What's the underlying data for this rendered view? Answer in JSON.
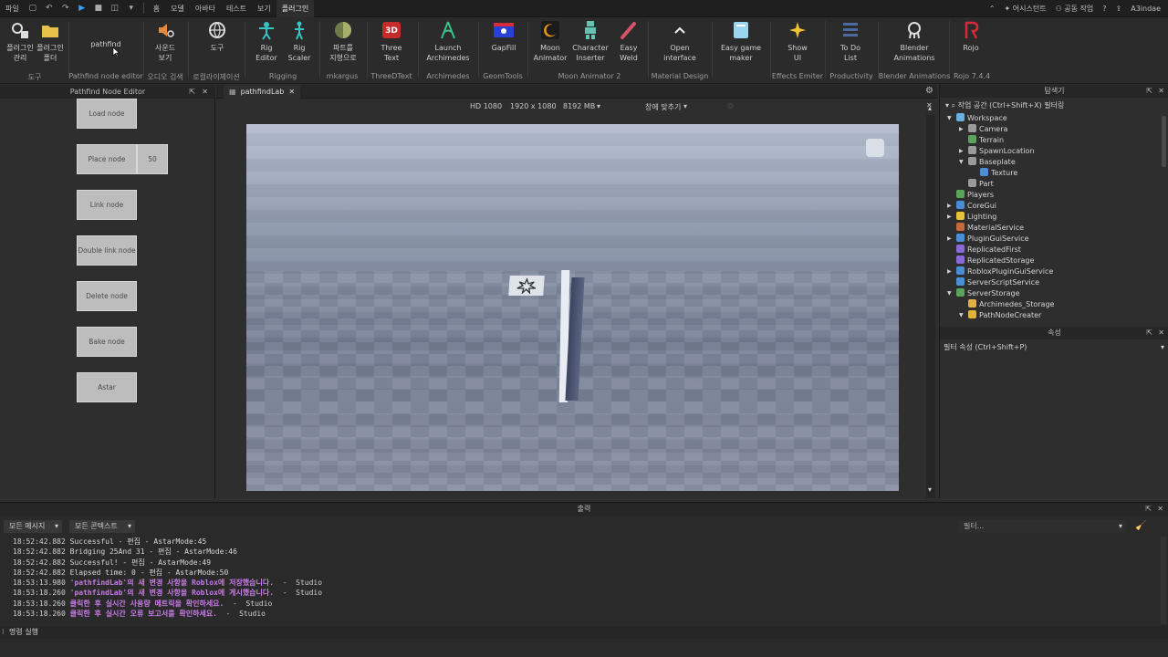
{
  "menubar": {
    "file": "파일",
    "tabs": [
      "홈",
      "모델",
      "아바타",
      "테스트",
      "보기",
      "플러그인"
    ],
    "active_tab": "플러그인",
    "assistant": "어시스턴트",
    "collab": "공동 작업",
    "user": "A3indae"
  },
  "ribbon": {
    "buttons": [
      {
        "label": "플러그인\n관리",
        "icon": "plugin-manage-icon"
      },
      {
        "label": "플러그인\n폴더",
        "icon": "folder-icon"
      },
      {
        "label": "pathfind",
        "icon": ""
      },
      {
        "label": "사운드\n보기",
        "icon": "sound-icon"
      },
      {
        "label": "도구",
        "icon": "globe-icon"
      },
      {
        "label": "Rig\nEditor",
        "icon": "rig-editor-icon"
      },
      {
        "label": "Rig\nScaler",
        "icon": "rig-scaler-icon"
      },
      {
        "label": "파트를\n지형으로",
        "icon": "sphere-icon"
      },
      {
        "label": "Three\nText",
        "icon": "3d-text-icon"
      },
      {
        "label": "Launch\nArchimedes",
        "icon": "archimedes-icon"
      },
      {
        "label": "GapFill",
        "icon": "gapfill-icon"
      },
      {
        "label": "Moon\nAnimator",
        "icon": "moon-icon"
      },
      {
        "label": "Character\nInserter",
        "icon": "character-icon"
      },
      {
        "label": "Easy\nWeld",
        "icon": "weld-icon"
      },
      {
        "label": "Open\ninterface",
        "icon": "chevron-up-icon"
      },
      {
        "label": "Easy game\nmaker",
        "icon": "game-maker-icon"
      },
      {
        "label": "Show\nUI",
        "icon": "sparkle-icon"
      },
      {
        "label": "To Do\nList",
        "icon": "list-icon"
      },
      {
        "label": "Blender\nAnimations",
        "icon": "blender-icon"
      },
      {
        "label": "Rojo",
        "icon": "rojo-icon"
      }
    ],
    "groups": [
      "도구",
      "Pathfind node editor",
      "오디오 검색",
      "로컬라이제이션",
      "Rigging",
      "mkargus",
      "ThreeDText",
      "Archimedes",
      "GeomTools",
      "Moon Animator 2",
      "Material Design",
      "Effects Emiter",
      "Productivity",
      "Blender Animations",
      "Rojo 7.4.4"
    ]
  },
  "left_panel": {
    "title": "Pathfind Node Editor",
    "buttons": [
      "Load node",
      "Place node",
      "Link node",
      "Double link node",
      "Delete node",
      "Bake node",
      "Astar"
    ],
    "place_value": "50"
  },
  "viewport": {
    "tab": "pathfindLab",
    "resolution_preset": "HD 1080",
    "resolution": "1920 x 1080",
    "memory": "8192 MB",
    "fit": "창에 맞추기"
  },
  "explorer": {
    "title": "탐색기",
    "filter": "작업 공간 (Ctrl+Shift+X) 필터링",
    "items": [
      {
        "label": "Workspace",
        "depth": 0,
        "arrow": "open",
        "icon_color": "#6ab0de"
      },
      {
        "label": "Camera",
        "depth": 1,
        "arrow": "closed",
        "icon_color": "#9a9a9a"
      },
      {
        "label": "Terrain",
        "depth": 1,
        "arrow": "",
        "icon_color": "#5aa35a"
      },
      {
        "label": "SpawnLocation",
        "depth": 1,
        "arrow": "closed",
        "icon_color": "#9a9a9a"
      },
      {
        "label": "Baseplate",
        "depth": 1,
        "arrow": "open",
        "icon_color": "#9a9a9a"
      },
      {
        "label": "Texture",
        "depth": 2,
        "arrow": "",
        "icon_color": "#4a8fd6"
      },
      {
        "label": "Part",
        "depth": 1,
        "arrow": "",
        "icon_color": "#9a9a9a"
      },
      {
        "label": "Players",
        "depth": 0,
        "arrow": "",
        "icon_color": "#5aa35a"
      },
      {
        "label": "CoreGui",
        "depth": 0,
        "arrow": "closed",
        "icon_color": "#4a8fd6"
      },
      {
        "label": "Lighting",
        "depth": 0,
        "arrow": "closed",
        "icon_color": "#e6c33a"
      },
      {
        "label": "MaterialService",
        "depth": 0,
        "arrow": "",
        "icon_color": "#c46a3a"
      },
      {
        "label": "PluginGuiService",
        "depth": 0,
        "arrow": "closed",
        "icon_color": "#4a8fd6"
      },
      {
        "label": "ReplicatedFirst",
        "depth": 0,
        "arrow": "",
        "icon_color": "#8a6ad6"
      },
      {
        "label": "ReplicatedStorage",
        "depth": 0,
        "arrow": "",
        "icon_color": "#8a6ad6"
      },
      {
        "label": "RobloxPluginGuiService",
        "depth": 0,
        "arrow": "closed",
        "icon_color": "#4a8fd6"
      },
      {
        "label": "ServerScriptService",
        "depth": 0,
        "arrow": "",
        "icon_color": "#4a8fd6"
      },
      {
        "label": "ServerStorage",
        "depth": 0,
        "arrow": "open",
        "icon_color": "#5aa35a"
      },
      {
        "label": "Archimedes_Storage",
        "depth": 1,
        "arrow": "",
        "icon_color": "#e0b43a"
      },
      {
        "label": "PathNodeCreater",
        "depth": 1,
        "arrow": "open",
        "icon_color": "#e0b43a"
      }
    ]
  },
  "properties": {
    "title": "속성",
    "filter": "필터 속성 (Ctrl+Shift+P)"
  },
  "output": {
    "title": "출력",
    "messages_dropdown": "모든 메시지",
    "context_dropdown": "모든 콘텍스트",
    "filter_placeholder": "필터...",
    "lines": [
      {
        "time": "18:52:42.882",
        "msg": "Successful  -  편집 - AstarMode:45",
        "kind": "normal"
      },
      {
        "time": "18:52:42.882",
        "msg": "Bridging 25And 31  -  편집 - AstarMode:46",
        "kind": "normal"
      },
      {
        "time": "18:52:42.882",
        "msg": "Successful!  -  편집 - AstarMode:49",
        "kind": "normal"
      },
      {
        "time": "18:52:42.882",
        "msg": "Elapsed time: 0  -  편집 - AstarMode:50",
        "kind": "normal"
      },
      {
        "time": "18:53:13.980",
        "msg": "'pathfindLab'의 새 변경 사항을 Roblox에 저장했습니다.",
        "src": "  -  Studio",
        "kind": "purple"
      },
      {
        "time": "18:53:18.260",
        "msg": "'pathfindLab'의 새 변경 사항을 Roblox에 게시했습니다.",
        "src": "  -  Studio",
        "kind": "purple"
      },
      {
        "time": "18:53:18.260",
        "msg": "클릭한 후 실시간 사용량 메트릭을 확인하세요.",
        "src": "  -  Studio",
        "kind": "purple"
      },
      {
        "time": "18:53:18.260",
        "msg": "클릭한 후 실시간 오류 보고서를 확인하세요.",
        "src": "  -  Studio",
        "kind": "purple"
      }
    ],
    "command_bar": "명령 실행"
  }
}
